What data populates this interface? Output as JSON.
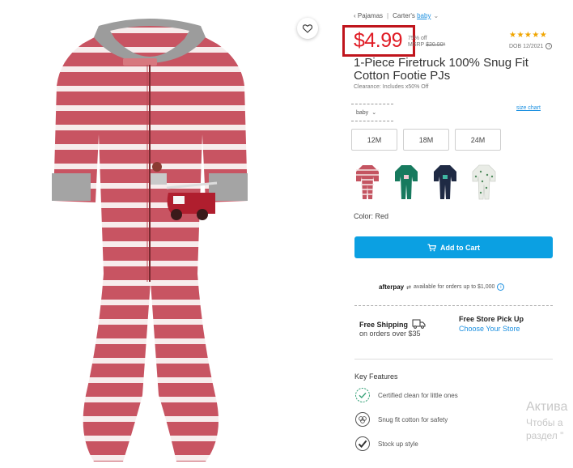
{
  "breadcrumb": {
    "back_label": "‹ Pajamas",
    "brand": "Carter's",
    "category": "baby",
    "chevron": "chevron-down-icon"
  },
  "price": {
    "current": "$4.99",
    "percent_off": "75% off",
    "msrp_label": "MSRP",
    "msrp_value": "$20.00*"
  },
  "rating": {
    "stars": "★★★★★",
    "value": 5,
    "max": 5,
    "dob": "DOB 12/2021",
    "info_icon": "i"
  },
  "product": {
    "title": "1-Piece Firetruck 100% Snug Fit Cotton Footie PJs",
    "clearance": "Clearance: Includes x50% Off"
  },
  "size_select": {
    "value": "baby",
    "size_chart": "size chart"
  },
  "sizes": [
    "12M",
    "18M",
    "24M"
  ],
  "swatches": [
    {
      "name": "swatch-red",
      "color": "#c45461"
    },
    {
      "name": "swatch-green",
      "color": "#177a5e"
    },
    {
      "name": "swatch-navy",
      "color": "#1f2a44"
    },
    {
      "name": "swatch-white-print",
      "color": "#e9ece6"
    }
  ],
  "color": {
    "label": "Color: Red"
  },
  "cart": {
    "button_label": "Add to Cart",
    "icon": "cart-icon"
  },
  "afterpay": {
    "logo": "afterpay",
    "text": "available for orders up to $1,000",
    "info_icon": "i"
  },
  "shipping": {
    "free_title": "Free Shipping",
    "free_sub": "on orders over $35",
    "pickup_title": "Free Store Pick Up",
    "pickup_link": "Choose Your Store"
  },
  "features": {
    "title": "Key Features",
    "items": [
      {
        "label": "Certified clean for little ones",
        "icon": "certified-check-icon"
      },
      {
        "label": "Snug fit cotton for safety",
        "icon": "cotton-icon"
      },
      {
        "label": "Stock up style",
        "icon": "checkmark-icon"
      }
    ]
  },
  "watermark": {
    "line1": "Актива",
    "line2": "Чтобы а",
    "line3": "раздел \""
  },
  "colors": {
    "accent": "#0ba0e2",
    "price_red": "#e01b24",
    "price_box": "#c0141c",
    "star": "#f0a500"
  }
}
